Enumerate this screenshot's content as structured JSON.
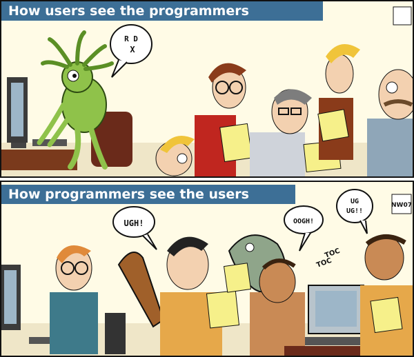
{
  "panels": [
    {
      "caption": "How users see the programmers",
      "speech": [
        "R D",
        "X"
      ]
    },
    {
      "caption": "How programmers see the users",
      "speech": [
        "UGH!",
        "OOGH!",
        "UG",
        "UG!!",
        "TOC",
        "TOC"
      ]
    }
  ],
  "colors": {
    "banner": "#3d6f96",
    "banner_text": "#ffffff",
    "background": "#fffbe6",
    "paper": "#f6f08a",
    "alien": "#8fc24a"
  },
  "logo": "NW07"
}
